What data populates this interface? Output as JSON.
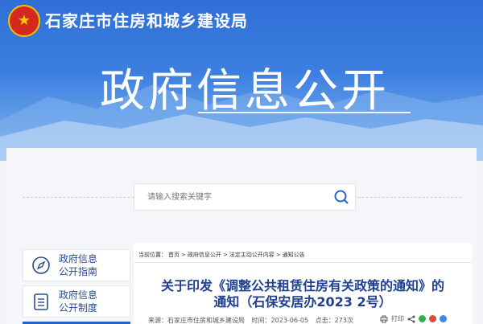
{
  "header": {
    "site_name": "石家庄市住房和城乡建设局",
    "big_title": "政府信息公开",
    "emblem_glyph": "★"
  },
  "search": {
    "placeholder": "请输入搜索关键字"
  },
  "sidebar": {
    "items": [
      {
        "label_line1": "政府信息",
        "label_line2": "公开指南",
        "icon": "compass-icon"
      },
      {
        "label_line1": "政府信息",
        "label_line2": "公开制度",
        "icon": "list-icon"
      }
    ]
  },
  "breadcrumb": {
    "prefix": "当前位置：",
    "items": [
      "首页",
      "政府信息公开",
      "法定主动公开内容",
      "通知公告"
    ],
    "sep": ">"
  },
  "article": {
    "title_line1": "关于印发《调整公共租赁住房有关政策的通知》的",
    "title_line2": "通知（石保安居办2023 2号）",
    "source": "来源：石家庄市住房和城乡建设局",
    "time": "时间：2023-06-05",
    "clicks": "点击：273次",
    "print_label": "打印"
  },
  "colors": {
    "accent": "#2563c6",
    "title": "#1f3f8f",
    "banner": "#3c7fe0"
  }
}
